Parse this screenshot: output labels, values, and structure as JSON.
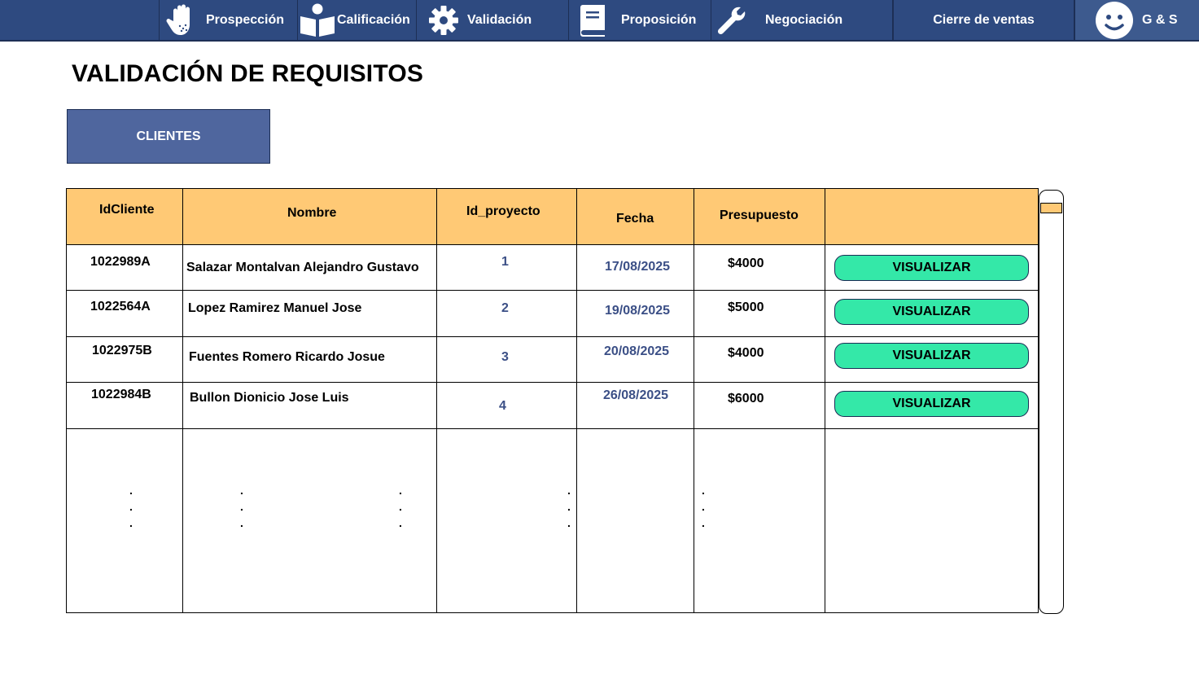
{
  "nav": {
    "items": [
      {
        "label": "Prospección",
        "icon": "hand-icon"
      },
      {
        "label": "Calificación",
        "icon": "reader-icon"
      },
      {
        "label": "Validación",
        "icon": "gear-icon"
      },
      {
        "label": "Proposición",
        "icon": "book-icon"
      },
      {
        "label": "Negociación",
        "icon": "wrench-icon"
      },
      {
        "label": "Cierre de ventas",
        "icon": ""
      }
    ],
    "user": {
      "label": "G & S",
      "icon": "smiley-icon"
    }
  },
  "page": {
    "title": "VALIDACIÓN DE REQUISITOS",
    "clients_button": "CLIENTES"
  },
  "table": {
    "headers": [
      "IdCliente",
      "Nombre",
      "Id_proyecto",
      "Fecha",
      "Presupuesto",
      ""
    ],
    "rows": [
      {
        "id": "1022989A",
        "nombre": "Salazar Montalvan Alejandro Gustavo",
        "proyecto": "1",
        "fecha": "17/08/2025",
        "presupuesto": "$4000",
        "action": "VISUALIZAR"
      },
      {
        "id": "1022564A",
        "nombre": "Lopez Ramirez Manuel Jose",
        "proyecto": "2",
        "fecha": "19/08/2025",
        "presupuesto": "$5000",
        "action": "VISUALIZAR"
      },
      {
        "id": "1022975B",
        "nombre": "Fuentes Romero Ricardo Josue",
        "proyecto": "3",
        "fecha": "20/08/2025",
        "presupuesto": "$4000",
        "action": "VISUALIZAR"
      },
      {
        "id": "1022984B",
        "nombre": "Bullon Dionicio Jose Luis",
        "proyecto": "4",
        "fecha": "26/08/2025",
        "presupuesto": "$6000",
        "action": "VISUALIZAR"
      }
    ],
    "continuation": "."
  },
  "colors": {
    "nav_bg": "#2e4a80",
    "header_bg": "#ffc975",
    "button_bg": "#4f669e",
    "action_bg": "#34e8a8",
    "accent_text": "#3b4f86"
  }
}
